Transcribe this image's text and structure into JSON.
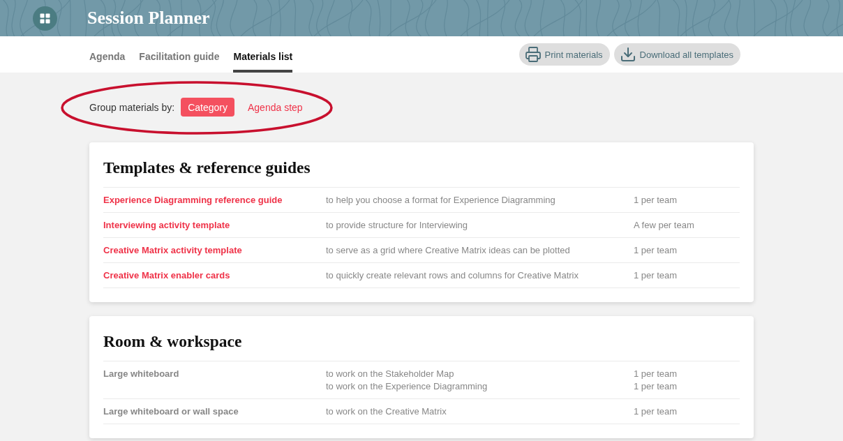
{
  "header": {
    "title": "Session Planner"
  },
  "tabs": [
    {
      "label": "Agenda",
      "selected": false
    },
    {
      "label": "Facilitation guide",
      "selected": false
    },
    {
      "label": "Materials list",
      "selected": true
    }
  ],
  "actions": [
    {
      "kind": "print",
      "label": "Print materials"
    },
    {
      "kind": "download",
      "label": "Download all templates"
    }
  ],
  "grouping": {
    "label": "Group materials by:",
    "highlighted": true,
    "options": [
      {
        "label": "Category",
        "selected": true
      },
      {
        "label": "Agenda step",
        "selected": false
      }
    ]
  },
  "sections": [
    {
      "title": "Templates & reference guides",
      "items": [
        {
          "name": "Experience Diagramming reference guide",
          "kind": "link",
          "uses": [
            {
              "purpose": "to help you choose a format for Experience Diagramming",
              "quantity": "1 per team"
            }
          ]
        },
        {
          "name": "Interviewing activity template",
          "kind": "link",
          "uses": [
            {
              "purpose": "to provide structure for Interviewing",
              "quantity": "A few per team"
            }
          ]
        },
        {
          "name": "Creative Matrix activity template",
          "kind": "link",
          "uses": [
            {
              "purpose": "to serve as a grid where Creative Matrix ideas can be plotted",
              "quantity": "1 per team"
            }
          ]
        },
        {
          "name": "Creative Matrix enabler cards",
          "kind": "link",
          "uses": [
            {
              "purpose": "to quickly create relevant rows and columns for Creative Matrix",
              "quantity": "1 per team"
            }
          ]
        }
      ]
    },
    {
      "title": "Room & workspace",
      "items": [
        {
          "name": "Large whiteboard",
          "kind": "text",
          "uses": [
            {
              "purpose": "to work on the Stakeholder Map",
              "quantity": "1 per team"
            },
            {
              "purpose": "to work on the Experience Diagramming",
              "quantity": "1 per team"
            }
          ]
        },
        {
          "name": "Large whiteboard or wall space",
          "kind": "text",
          "uses": [
            {
              "purpose": "to work on the Creative Matrix",
              "quantity": "1 per team"
            }
          ]
        }
      ]
    }
  ]
}
